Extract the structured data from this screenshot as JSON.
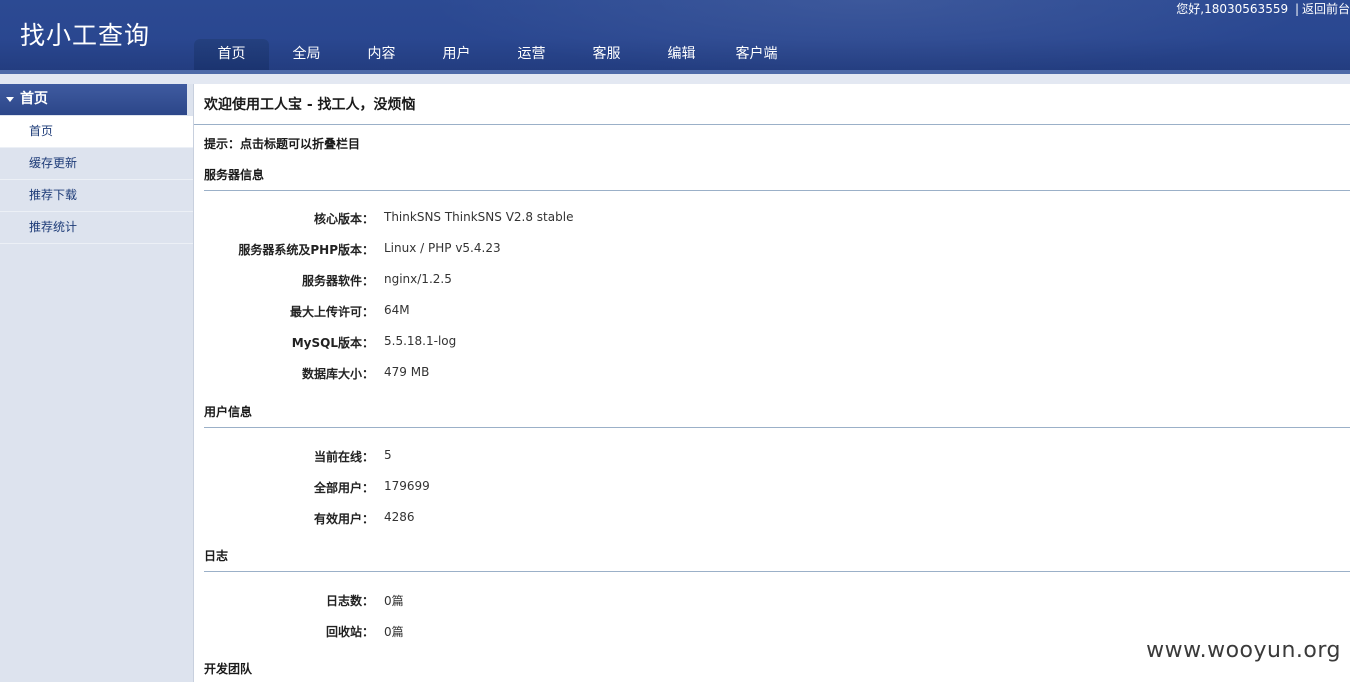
{
  "header": {
    "logo": "找小工查询",
    "greeting": "您好,18030563559",
    "separator": "|",
    "back_link": "返回前台",
    "nav": [
      {
        "label": "首页",
        "active": true
      },
      {
        "label": "全局",
        "active": false
      },
      {
        "label": "内容",
        "active": false
      },
      {
        "label": "用户",
        "active": false
      },
      {
        "label": "运营",
        "active": false
      },
      {
        "label": "客服",
        "active": false
      },
      {
        "label": "编辑",
        "active": false
      },
      {
        "label": "客户端",
        "active": false
      }
    ]
  },
  "sidebar": {
    "heading": "首页",
    "items": [
      {
        "label": "首页",
        "active": true
      },
      {
        "label": "缓存更新",
        "active": false
      },
      {
        "label": "推荐下载",
        "active": false
      },
      {
        "label": "推荐统计",
        "active": false
      }
    ]
  },
  "main": {
    "welcome": "欢迎使用工人宝 - 找工人，没烦恼",
    "tip": "提示：点击标题可以折叠栏目",
    "sections": {
      "server": {
        "title": "服务器信息",
        "rows": [
          {
            "label": "核心版本：",
            "value": "ThinkSNS ThinkSNS V2.8 stable"
          },
          {
            "label": "服务器系统及PHP版本：",
            "value": "Linux / PHP v5.4.23"
          },
          {
            "label": "服务器软件：",
            "value": "nginx/1.2.5"
          },
          {
            "label": "最大上传许可：",
            "value": "64M"
          },
          {
            "label": "MySQL版本：",
            "value": "5.5.18.1-log"
          },
          {
            "label": "数据库大小：",
            "value": "479 MB"
          }
        ]
      },
      "users": {
        "title": "用户信息",
        "rows": [
          {
            "label": "当前在线：",
            "value": "5"
          },
          {
            "label": "全部用户：",
            "value": "179699"
          },
          {
            "label": "有效用户：",
            "value": "4286"
          }
        ]
      },
      "log": {
        "title": "日志",
        "rows": [
          {
            "label": "日志数：",
            "value": "0篇"
          },
          {
            "label": "回收站：",
            "value": "0篇"
          }
        ]
      },
      "team": {
        "title": "开发团队"
      }
    }
  },
  "watermark": "www.wooyun.org",
  "colors": {
    "header_blue": "#2a4790",
    "sidebar_bg": "#dde3ee",
    "link_blue": "#1e3c78",
    "divider": "#9bb0c8"
  }
}
